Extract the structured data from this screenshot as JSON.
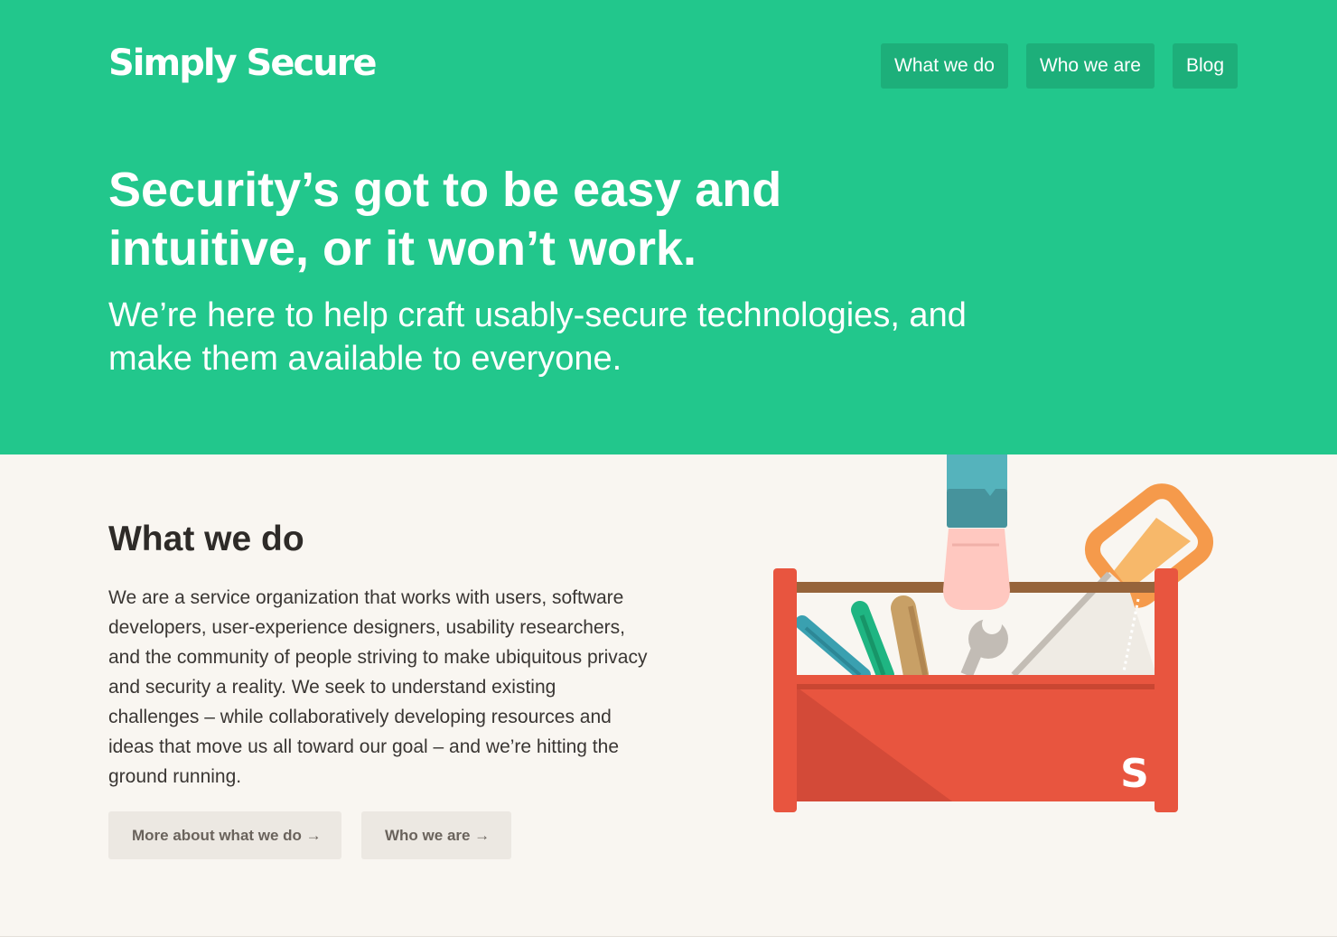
{
  "header": {
    "logo_text": "Simply Secure",
    "nav": [
      {
        "label": "What we do"
      },
      {
        "label": "Who we are"
      },
      {
        "label": "Blog"
      }
    ]
  },
  "hero": {
    "headline": "Security’s got to be easy and intuitive, or it won’t work.",
    "subheadline": "We’re here to help craft usably-secure technologies, and make them available to everyone."
  },
  "what_we_do": {
    "title": "What we do",
    "body": "We are a service organization that works with users, software developers, user-experience designers, usability researchers, and the community of people striving to make ubiquitous privacy and security a reality. We seek to understand existing challenges – while collaboratively developing resources and ideas that move us all toward our goal – and we’re hitting the ground running.",
    "buttons": [
      {
        "label": "More about what we do →"
      },
      {
        "label": "Who we are →"
      }
    ],
    "illustration": {
      "toolbox_letter": "S"
    }
  },
  "colors": {
    "brand_green": "#22c78c",
    "nav_button": "#1daf7a",
    "toolbox_red": "#e8553f",
    "background": "#f9f6f1"
  }
}
